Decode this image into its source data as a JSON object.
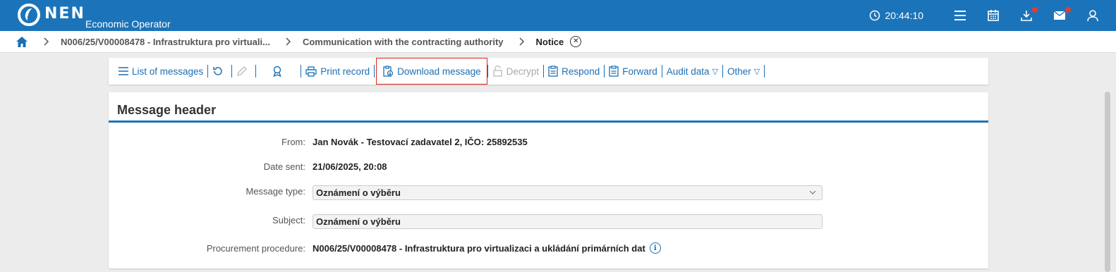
{
  "app": {
    "brand": "NEN",
    "subtitle": "Economic Operator",
    "time": "20:44:10",
    "colors": {
      "header": "#1b74ba",
      "link": "#1b6fb5",
      "highlight": "#d9261c",
      "badge": "#e53935"
    }
  },
  "breadcrumb": {
    "items": [
      "N006/25/V00008478 - Infrastruktura pro virtuali...",
      "Communication with the contracting authority",
      "Notice"
    ]
  },
  "toolbar": {
    "list_messages": "List of messages",
    "print_record": "Print record",
    "download_message": "Download message",
    "decrypt": "Decrypt",
    "respond": "Respond",
    "forward": "Forward",
    "audit_data": "Audit data",
    "other": "Other",
    "dropdown_glyph": "▽"
  },
  "message": {
    "title": "Message header",
    "from_label": "From:",
    "from_value": "Jan Novák - Testovací zadavatel 2, IČO: 25892535",
    "date_label": "Date sent:",
    "date_value": "21/06/2025, 20:08",
    "type_label": "Message type:",
    "type_value": "Oznámení o výběru",
    "subject_label": "Subject:",
    "subject_value": "Oznámení o výběru",
    "procedure_label": "Procurement procedure:",
    "procedure_value": "N006/25/V00008478 - Infrastruktura pro virtualizaci a ukládání primárních dat"
  }
}
